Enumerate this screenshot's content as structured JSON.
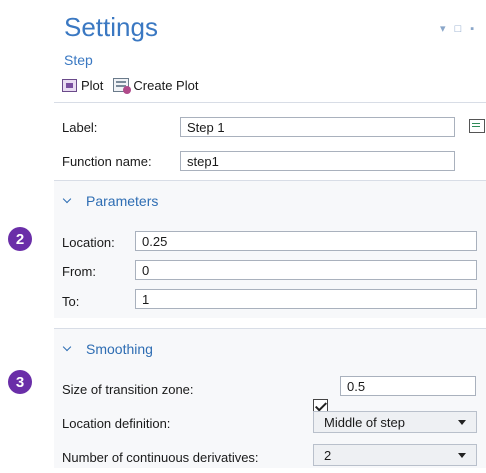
{
  "header": {
    "title": "Settings",
    "subtitle": "Step",
    "window_controls": "▾ □ ▪"
  },
  "toolbar": {
    "plot_label": "Plot",
    "create_plot_label": "Create Plot"
  },
  "general": {
    "label_label": "Label:",
    "label_value": "Step 1",
    "function_name_label": "Function name:",
    "function_name_value": "step1"
  },
  "parameters": {
    "heading": "Parameters",
    "badge": "2",
    "location_label": "Location:",
    "location_value": "0.25",
    "from_label": "From:",
    "from_value": "0",
    "to_label": "To:",
    "to_value": "1"
  },
  "smoothing": {
    "heading": "Smoothing",
    "badge": "3",
    "transition_label": "Size of transition zone:",
    "transition_checked": true,
    "transition_value": "0.5",
    "location_definition_label": "Location definition:",
    "location_definition_value": "Middle of step",
    "derivatives_label": "Number of continuous derivatives:",
    "derivatives_value": "2"
  },
  "colors": {
    "accent": "#3a78c2",
    "badge": "#6a2ea8"
  }
}
